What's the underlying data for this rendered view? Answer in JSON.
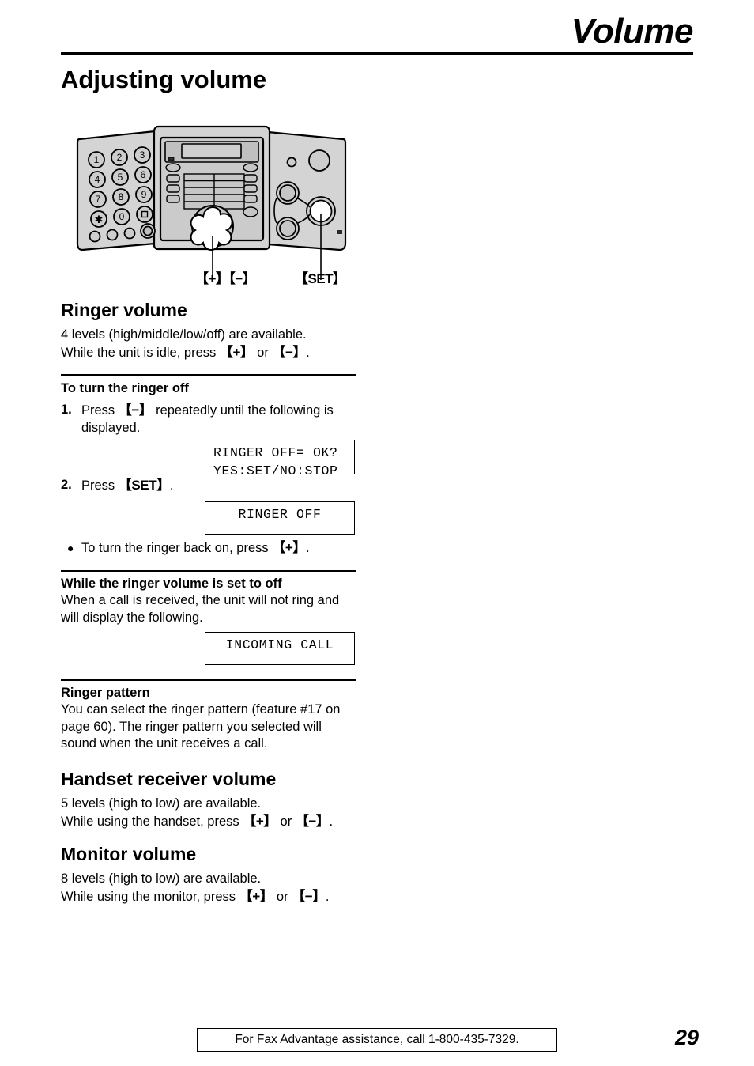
{
  "header": {
    "title": "Volume"
  },
  "page_title": "Adjusting volume",
  "figure": {
    "keypad": [
      "1",
      "2",
      "3",
      "4",
      "5",
      "6",
      "7",
      "8",
      "9",
      "✱",
      "0",
      "□"
    ],
    "callouts": {
      "plus_minus": "【+】【−】",
      "set": "【SET】"
    }
  },
  "sections": {
    "ringer_volume": {
      "heading": "Ringer volume",
      "line1": "4 levels (high/middle/low/off) are available.",
      "line2_pre": "While the unit is idle, press ",
      "line2_key1": "【+】",
      "line2_mid": " or ",
      "line2_key2": "【−】",
      "line2_post": "."
    },
    "turn_ringer_off": {
      "heading": "To turn the ringer off",
      "step1_num": "1.",
      "step1_pre": "Press ",
      "step1_key": "【−】",
      "step1_post": " repeatedly until the following is displayed.",
      "display1_line1": "RINGER OFF= OK?",
      "display1_line2": "YES:SET/NO:STOP",
      "step2_num": "2.",
      "step2_pre": "Press ",
      "step2_key": "【SET】",
      "step2_post": ".",
      "display2_line1": "RINGER OFF",
      "display2_line2": "",
      "bullet_pre": "To turn the ringer back on, press ",
      "bullet_key": "【+】",
      "bullet_post": "."
    },
    "ringer_set_off": {
      "heading": "While the ringer volume is set to off",
      "body": "When a call is received, the unit will not ring and will display the following.",
      "display_line1": "INCOMING CALL",
      "display_line2": ""
    },
    "ringer_pattern": {
      "heading": "Ringer pattern",
      "body": "You can select the ringer pattern (feature #17 on page 60). The ringer pattern you selected will sound when the unit receives a call."
    },
    "handset_receiver_volume": {
      "heading": "Handset receiver volume",
      "line1": "5 levels (high to low) are available.",
      "line2_pre": "While using the handset, press ",
      "line2_key1": "【+】",
      "line2_mid": " or ",
      "line2_key2": "【−】",
      "line2_post": "."
    },
    "monitor_volume": {
      "heading": "Monitor volume",
      "line1": "8 levels (high to low) are available.",
      "line2_pre": "While using the monitor, press ",
      "line2_key1": "【+】",
      "line2_mid": " or ",
      "line2_key2": "【−】",
      "line2_post": "."
    }
  },
  "footer": {
    "assistance": "For Fax Advantage assistance, call 1-800-435-7329.",
    "page_number": "29"
  },
  "colors": {
    "ink": "#000000",
    "paper": "#ffffff",
    "device_body": "#d4d4d4",
    "device_panel": "#c4c4c4",
    "device_dark": "#b0b0b0"
  }
}
